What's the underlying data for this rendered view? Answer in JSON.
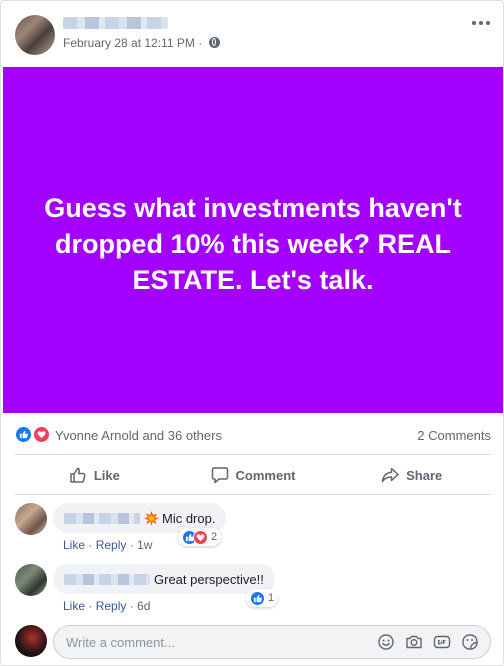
{
  "post": {
    "date": "February 28 at 12:11 PM",
    "date_separator": "·",
    "banner_text": "Guess what investments haven't dropped 10% this week? REAL ESTATE. Let's talk.",
    "banner_color": "#a400ff"
  },
  "reactions": {
    "summary": "Yvonne Arnold and 36 others",
    "comments_count": "2 Comments"
  },
  "actions": {
    "like": "Like",
    "comment": "Comment",
    "share": "Share"
  },
  "comments": [
    {
      "text": "Mic drop.",
      "emoji": "collision-emoji",
      "like_label": "Like",
      "reply_label": "Reply",
      "time": "1w",
      "reaction_count": "2",
      "reaction_types": [
        "like",
        "love"
      ]
    },
    {
      "text": "Great perspective!!",
      "like_label": "Like",
      "reply_label": "Reply",
      "time": "6d",
      "reaction_count": "1",
      "reaction_types": [
        "like"
      ]
    }
  ],
  "composer": {
    "placeholder": "Write a comment..."
  },
  "icons": {
    "header_more": "more-horizontal-icon",
    "privacy": "globe-icon",
    "composer": [
      "emoji-icon",
      "camera-icon",
      "gif-icon",
      "sticker-icon"
    ]
  },
  "colors": {
    "facebook_blue": "#1877f2",
    "love_red": "#f33e58",
    "link_blue": "#385898"
  }
}
